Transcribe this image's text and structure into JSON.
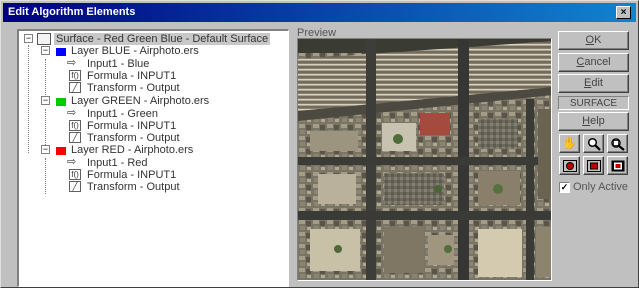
{
  "window": {
    "title": "Edit Algorithm Elements",
    "close_glyph": "×"
  },
  "tree": {
    "root": {
      "label": "Surface - Red Green Blue - Default Surface",
      "expander": "−"
    },
    "layers": [
      {
        "label": "Layer BLUE - Airphoto.ers",
        "color": "#0000ff",
        "expander": "−",
        "children": [
          {
            "icon": "input-arrow-icon",
            "label": "Input1 - Blue"
          },
          {
            "icon": "formula-icon",
            "label": "Formula - INPUT1"
          },
          {
            "icon": "transform-icon",
            "label": "Transform - Output"
          }
        ]
      },
      {
        "label": "Layer GREEN - Airphoto.ers",
        "color": "#00cc00",
        "expander": "−",
        "children": [
          {
            "icon": "input-arrow-icon",
            "label": "Input1 - Green"
          },
          {
            "icon": "formula-icon",
            "label": "Formula - INPUT1"
          },
          {
            "icon": "transform-icon",
            "label": "Transform - Output"
          }
        ]
      },
      {
        "label": "Layer RED - Airphoto.ers",
        "color": "#ff0000",
        "expander": "−",
        "children": [
          {
            "icon": "input-arrow-icon",
            "label": "Input1 - Red"
          },
          {
            "icon": "formula-icon",
            "label": "Formula - INPUT1"
          },
          {
            "icon": "transform-icon",
            "label": "Transform - Output"
          }
        ]
      }
    ]
  },
  "preview": {
    "label": "Preview"
  },
  "buttons": {
    "ok": {
      "first": "O",
      "rest": "K"
    },
    "cancel": {
      "first": "C",
      "rest": "ancel"
    },
    "edit": {
      "first": "E",
      "rest": "dit"
    },
    "surface": "SURFACE",
    "help": {
      "first": "H",
      "rest": "elp"
    }
  },
  "tools": {
    "row1": [
      "hand-icon",
      "zoom-in-icon",
      "zoom-box-icon"
    ],
    "row2": [
      "zoom-fit-icon",
      "zoom-dataset-icon",
      "zoom-all-icon"
    ]
  },
  "only_active": {
    "label": "Only Active",
    "checked": true,
    "mark": "✓"
  }
}
